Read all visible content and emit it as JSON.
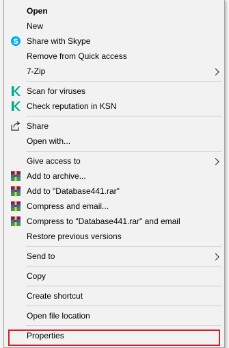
{
  "menu": {
    "open": "Open",
    "new": "New",
    "share_skype": "Share with Skype",
    "remove_quick_access": "Remove from Quick access",
    "sevenzip": "7-Zip",
    "scan_viruses": "Scan for viruses",
    "check_reputation": "Check reputation in KSN",
    "share": "Share",
    "open_with": "Open with...",
    "give_access": "Give access to",
    "add_archive": "Add to archive...",
    "add_to_rar": "Add to \"Database441.rar\"",
    "compress_email": "Compress and email...",
    "compress_rar_email": "Compress to \"Database441.rar\" and email",
    "restore_versions": "Restore previous versions",
    "send_to": "Send to",
    "copy": "Copy",
    "create_shortcut": "Create shortcut",
    "open_file_location": "Open file location",
    "properties": "Properties"
  },
  "icons": {
    "skype": "skype-icon",
    "kaspersky": "kaspersky-icon",
    "share": "share-icon",
    "winrar": "winrar-icon",
    "submenu": "chevron-right-icon"
  },
  "colors": {
    "menu_bg": "#f2f2f2",
    "separator": "#cccccc",
    "highlight": "#d32027",
    "skype": "#00aff0",
    "kaspersky": "#00a88e"
  }
}
